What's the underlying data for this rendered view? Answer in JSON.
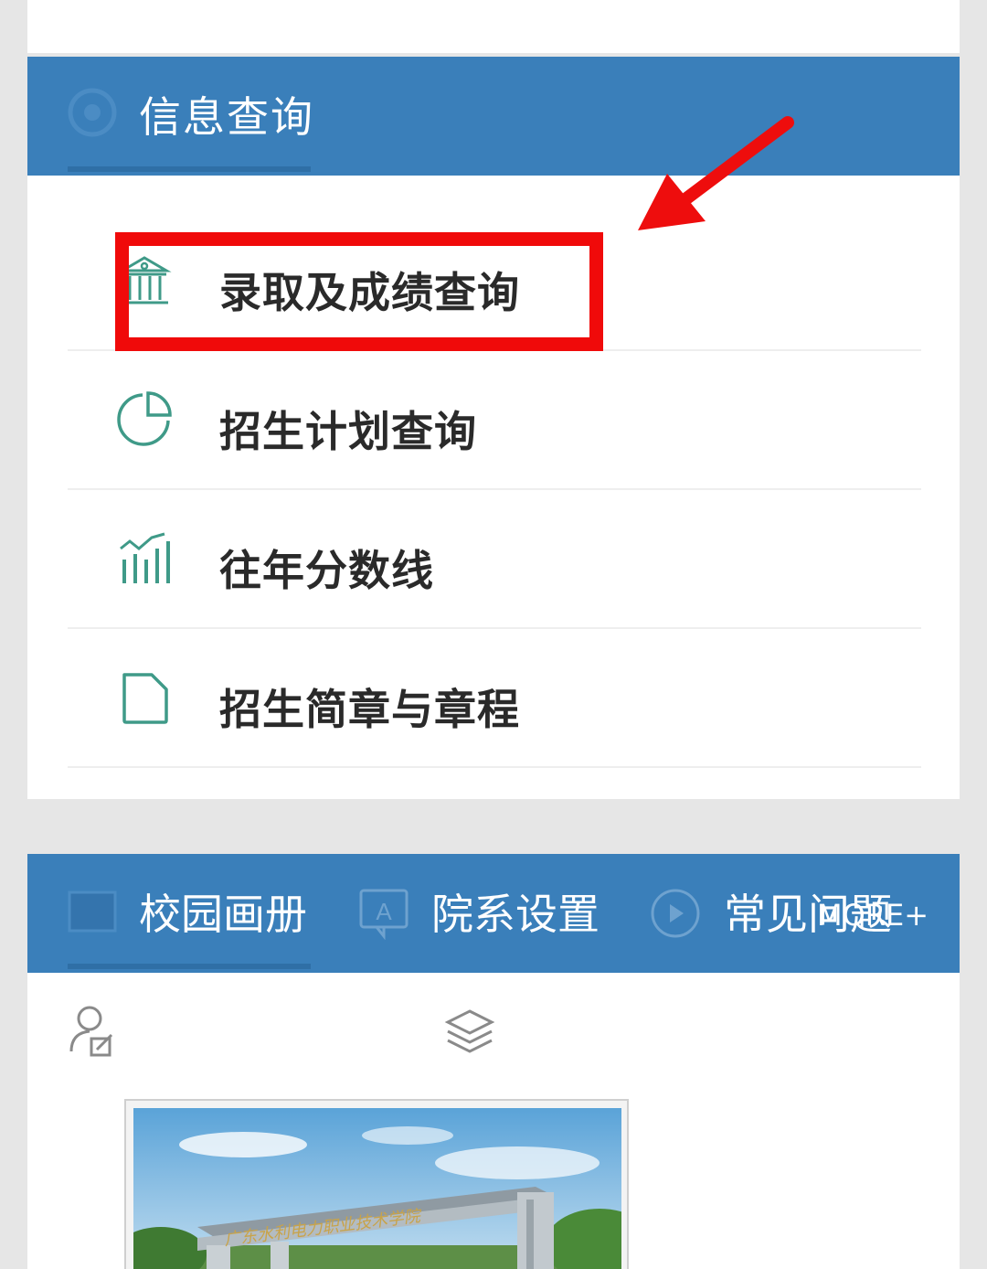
{
  "info_section": {
    "title": "信息查询",
    "items": [
      {
        "label": "录取及成绩查询",
        "icon": "bank-icon"
      },
      {
        "label": "招生计划查询",
        "icon": "pie-chart-icon"
      },
      {
        "label": "往年分数线",
        "icon": "bar-chart-icon"
      },
      {
        "label": "招生简章与章程",
        "icon": "document-icon"
      }
    ]
  },
  "gallery_section": {
    "tabs": [
      {
        "label": "校园画册",
        "icon": "image-icon"
      },
      {
        "label": "院系设置",
        "icon": "font-icon"
      },
      {
        "label": "常见问题",
        "icon": "play-icon"
      }
    ],
    "more_label": "MORE+",
    "sub_icons": [
      "user-edit-icon",
      "layers-icon"
    ],
    "photo_sign_text": "广东水利电力职业技术学院"
  },
  "colors": {
    "header_blue": "#3a7fba",
    "icon_teal": "#3f9a88",
    "highlight_red": "#f00a0a"
  }
}
